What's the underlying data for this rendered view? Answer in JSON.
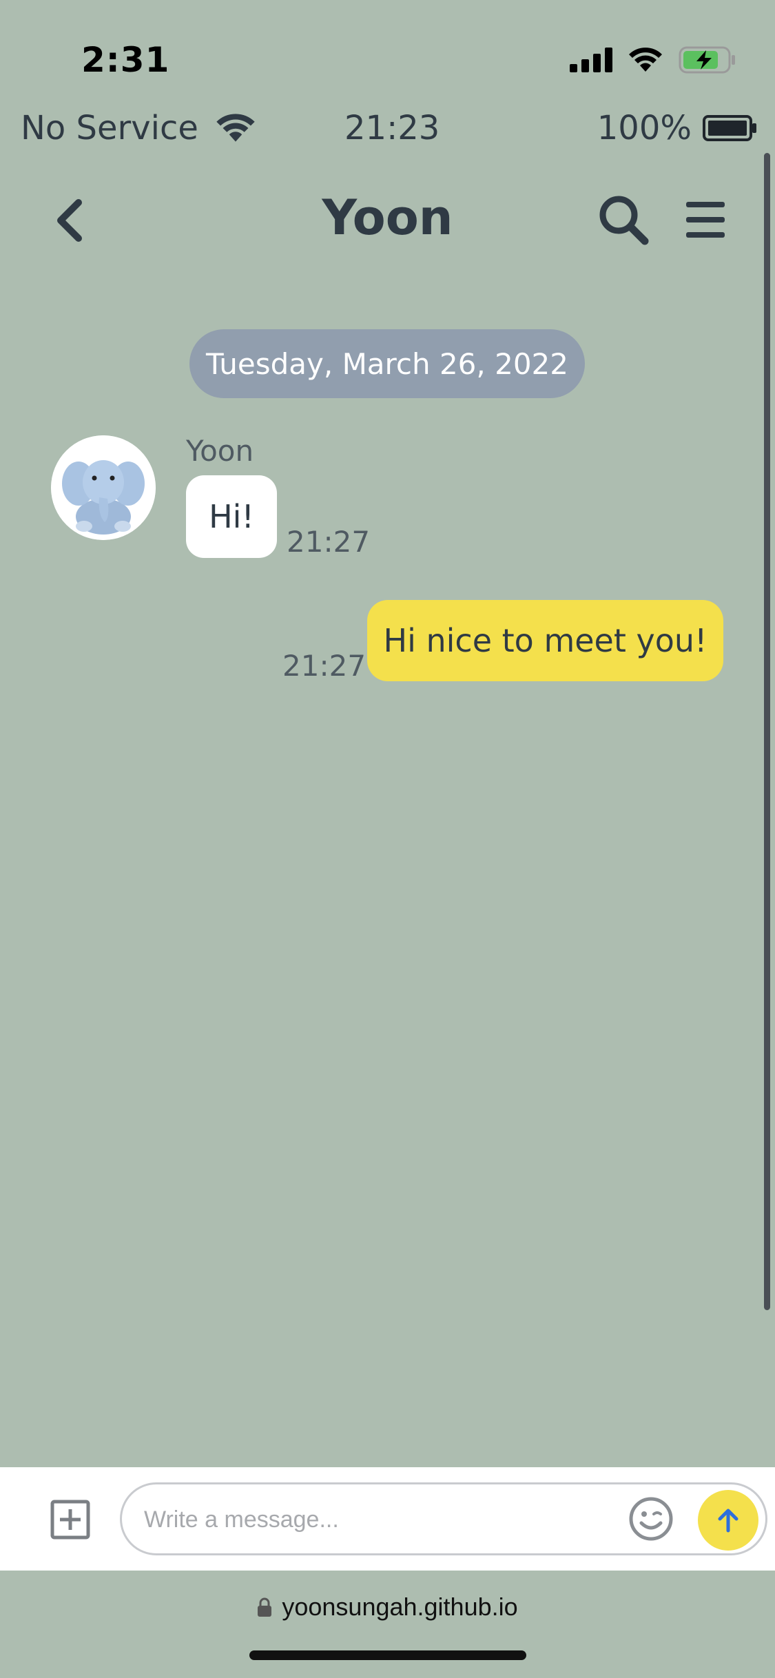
{
  "ios_status": {
    "time": "2:31"
  },
  "app_status": {
    "carrier": "No Service",
    "time": "21:23",
    "battery": "100%"
  },
  "header": {
    "title": "Yoon"
  },
  "conversation": {
    "date_separator": "Tuesday, March 26, 2022",
    "messages": [
      {
        "direction": "incoming",
        "sender": "Yoon",
        "text": "Hi!",
        "time": "21:27"
      },
      {
        "direction": "outgoing",
        "text": "Hi nice to meet you!",
        "time": "21:27"
      }
    ]
  },
  "composer": {
    "placeholder": "Write a message...",
    "value": ""
  },
  "browser": {
    "url": "yoonsungah.github.io"
  },
  "colors": {
    "background": "#adbdb0",
    "outgoing_bubble": "#f4e04c",
    "incoming_bubble": "#ffffff",
    "date_pill": "#919eae",
    "send_button": "#f4e04c",
    "send_arrow": "#2f6fdc"
  },
  "icons": [
    "back-icon",
    "search-icon",
    "menu-icon",
    "attach-icon",
    "emoji-icon",
    "send-icon",
    "lock-icon",
    "wifi-icon",
    "battery-icon",
    "signal-icon"
  ]
}
